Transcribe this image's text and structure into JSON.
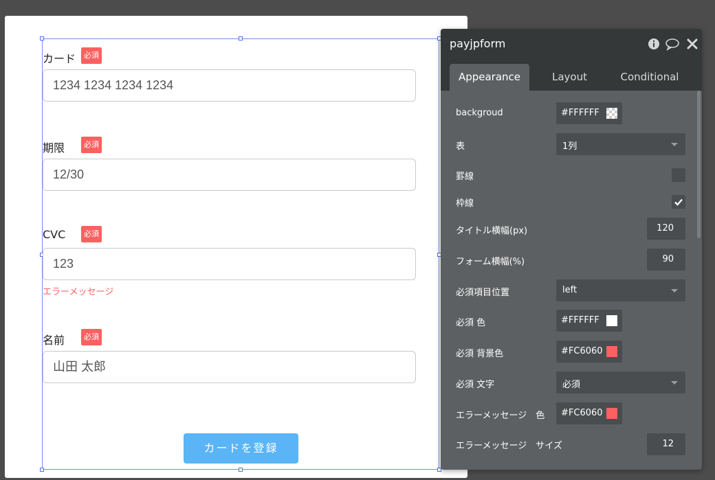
{
  "form": {
    "fields": [
      {
        "label": "カード",
        "value": "1234 1234 1234 1234"
      },
      {
        "label": "期限",
        "value": "12/30"
      },
      {
        "label": "CVC",
        "value": "123"
      },
      {
        "label": "名前",
        "value": "山田 太郎"
      }
    ],
    "required_badge": "必須",
    "error_message": "エラーメッセージ",
    "submit_label": "カードを登録"
  },
  "panel": {
    "title": "payjpform",
    "tabs": [
      "Appearance",
      "Layout",
      "Conditional"
    ],
    "active_tab": "Appearance",
    "properties": {
      "background_label": "backgroud",
      "background_value": "#FFFFFF",
      "table_label": "表",
      "table_value": "1列",
      "rule_label": "罫線",
      "rule_checked": false,
      "border_label": "枠線",
      "border_checked": true,
      "title_width_label": "タイトル横幅(px)",
      "title_width_value": "120",
      "form_width_label": "フォーム横幅(%)",
      "form_width_value": "90",
      "required_position_label": "必須項目位置",
      "required_position_value": "left",
      "required_color_label": "必須 色",
      "required_color_value": "#FFFFFF",
      "required_bg_label": "必須 背景色",
      "required_bg_value": "#FC6060",
      "required_text_label": "必須 文字",
      "required_text_value": "必須",
      "error_color_label": "エラーメッセージ　色",
      "error_color_value": "#FC6060",
      "error_size_label": "エラーメッセージ　サイズ",
      "error_size_value": "12"
    }
  },
  "colors": {
    "required_bg": "#FC6060",
    "required_text": "#FFFFFF",
    "error": "#FC6060",
    "button": "#5AB4F5",
    "panel_bg": "#5D6062",
    "panel_header": "#343839",
    "selection": "#6F8EF0"
  },
  "icons": {
    "info": "info-icon",
    "comment": "comment-icon",
    "close": "close-icon",
    "checkmark": "checkmark-icon",
    "dropdown": "chevron-down-icon"
  }
}
